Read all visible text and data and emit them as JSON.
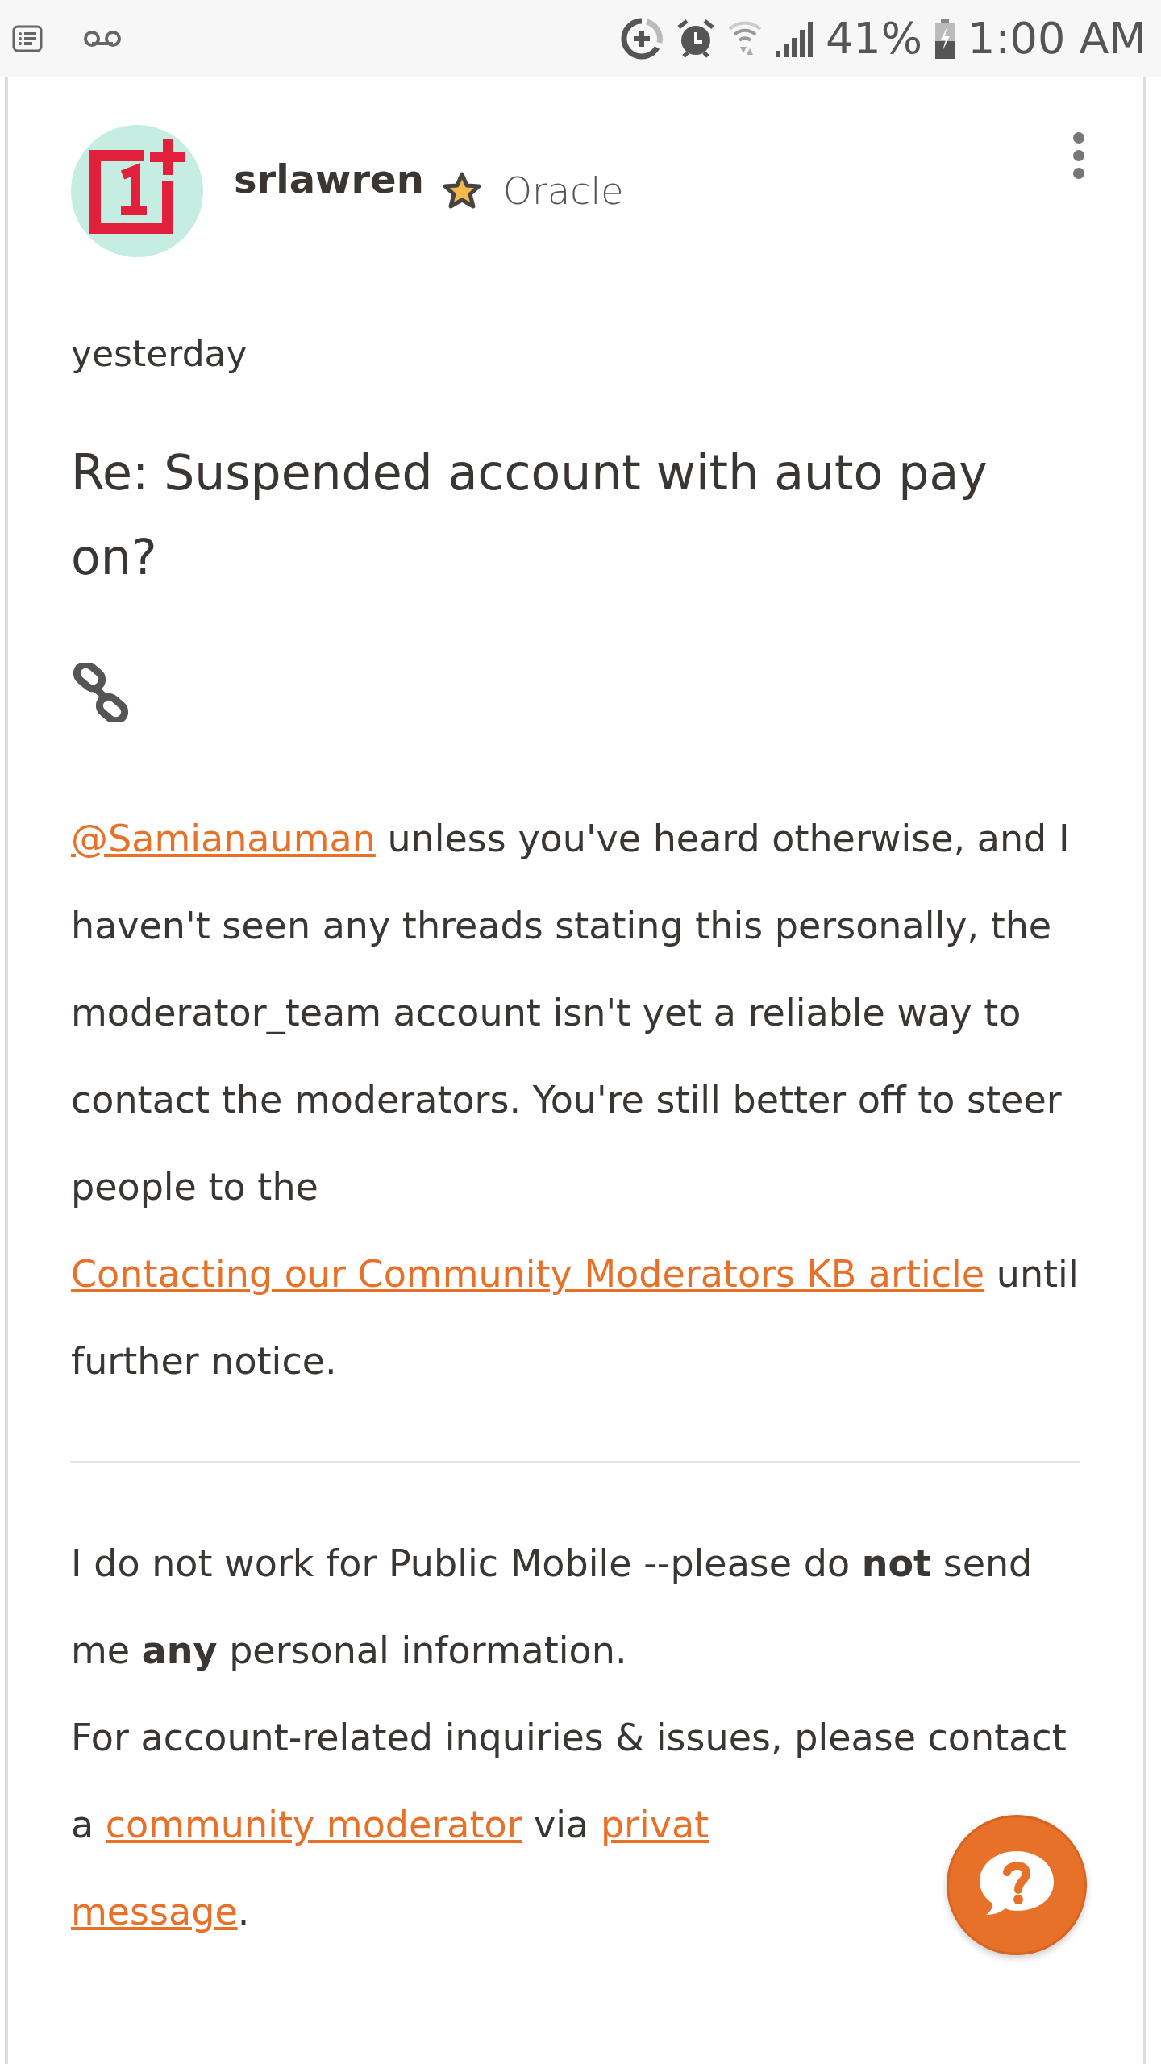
{
  "status_bar": {
    "battery": "41%",
    "time": "1:00 AM"
  },
  "post": {
    "author": "srlawren",
    "rank": "Oracle",
    "date": "yesterday",
    "title": "Re: Suspended account with auto pay on?",
    "body": [
      {
        "kind": "link",
        "text": "@Samianauman"
      },
      {
        "kind": "text",
        "text": " unless you've heard otherwise, and I haven't seen any threads stating this personally, the moderator_team account isn't yet a reliable way to contact the moderators.  You're still better off to steer people to the "
      },
      {
        "kind": "link",
        "text": "Contacting our Community Moderators KB article"
      },
      {
        "kind": "text",
        "text": " until further notice."
      }
    ],
    "signature": [
      [
        {
          "kind": "text",
          "text": "I do not work for Public Mobile --please do "
        },
        {
          "kind": "bold",
          "text": "not"
        },
        {
          "kind": "text",
          "text": " send me "
        },
        {
          "kind": "bold",
          "text": "any"
        },
        {
          "kind": "text",
          "text": " personal information."
        }
      ],
      [
        {
          "kind": "text",
          "text": "For account-related inquiries & issues, please contact a "
        },
        {
          "kind": "link",
          "text": "community moderator"
        },
        {
          "kind": "text",
          "text": " via "
        },
        {
          "kind": "link",
          "text": "privat"
        },
        {
          "kind": "break"
        },
        {
          "kind": "link",
          "text": "message"
        },
        {
          "kind": "text",
          "text": "."
        }
      ]
    ]
  }
}
